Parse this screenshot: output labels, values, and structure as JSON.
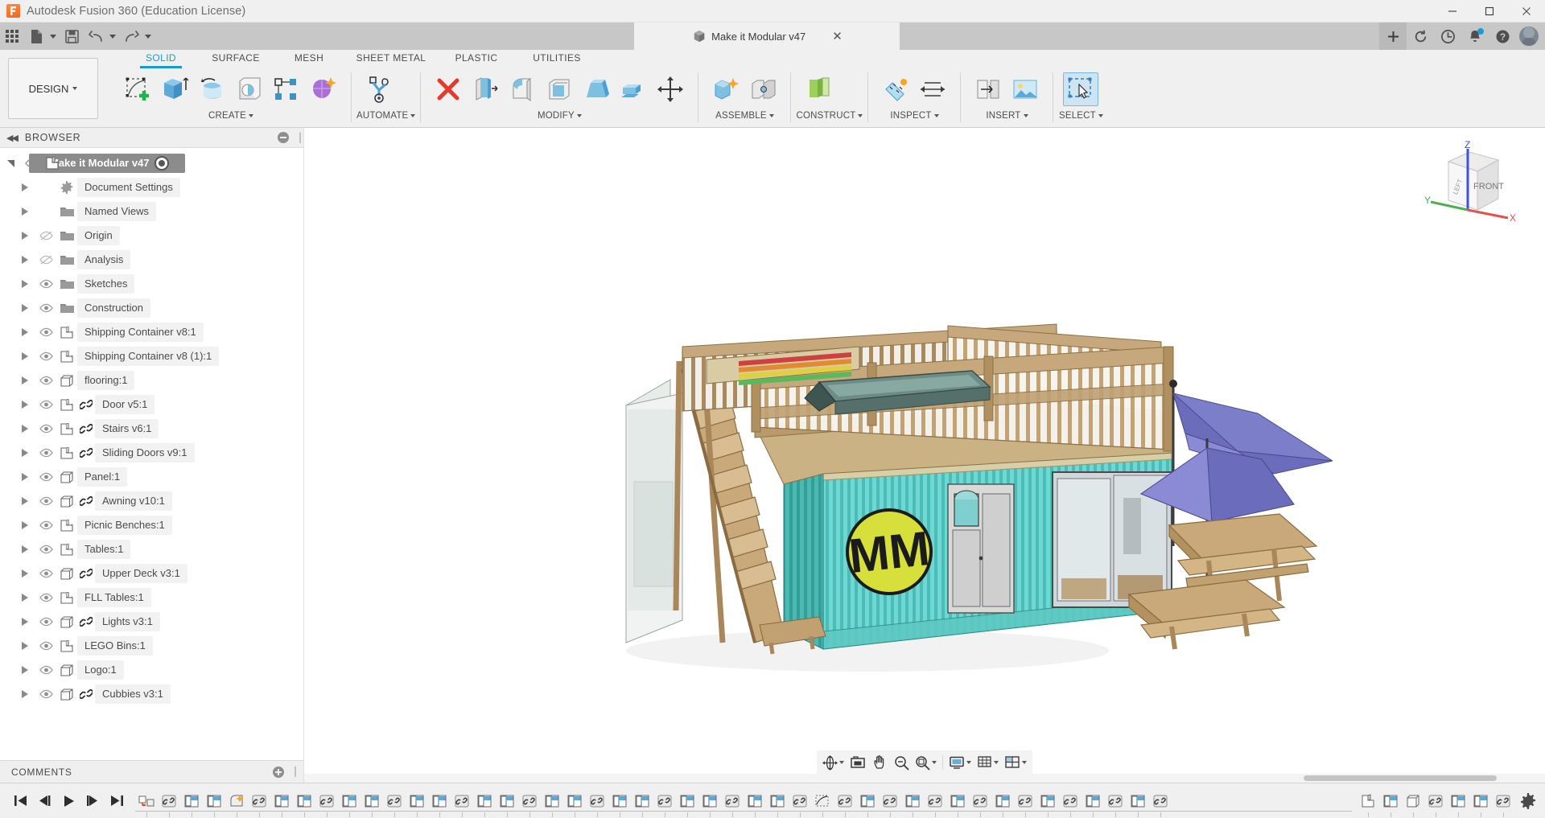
{
  "titlebar": {
    "app_title": "Autodesk Fusion 360 (Education License)",
    "icon": "fusion-logo-icon",
    "minimize": "–",
    "maximize": "□",
    "close": "✕"
  },
  "quick_access": {
    "app_grid": "grid-icon",
    "new_file": "new-file-icon",
    "save": "save-icon",
    "undo": "undo-icon",
    "redo": "redo-icon",
    "document_tab": {
      "title": "Make it Modular v47",
      "close": "✕"
    },
    "add_tab": "+",
    "sync_icon": "sync-icon",
    "history_icon": "clock-icon",
    "notifications_icon": "bell-icon",
    "help_icon": "help-icon",
    "avatar": "user-avatar"
  },
  "ribbon": {
    "workspace": "DESIGN",
    "tabs": [
      {
        "label": "SOLID",
        "active": true
      },
      {
        "label": "SURFACE",
        "active": false
      },
      {
        "label": "MESH",
        "active": false
      },
      {
        "label": "SHEET METAL",
        "active": false
      },
      {
        "label": "PLASTIC",
        "active": false
      },
      {
        "label": "UTILITIES",
        "active": false
      }
    ],
    "panels": [
      {
        "label": "CREATE",
        "has_caret": true,
        "tools": [
          "create-sketch-icon",
          "extrude-icon",
          "revolve-icon",
          "hole-icon",
          "pattern-icon",
          "form-icon"
        ]
      },
      {
        "label": "AUTOMATE",
        "has_caret": true,
        "tools": [
          "automate-generative-icon"
        ]
      },
      {
        "label": "MODIFY",
        "has_caret": true,
        "tools": [
          "delete-icon",
          "press-pull-icon",
          "fillet-icon",
          "shell-icon",
          "draft-icon",
          "combine-icon",
          "move-copy-icon"
        ]
      },
      {
        "label": "ASSEMBLE",
        "has_caret": true,
        "tools": [
          "new-component-icon",
          "joint-icon"
        ]
      },
      {
        "label": "CONSTRUCT",
        "has_caret": true,
        "tools": [
          "offset-plane-icon"
        ]
      },
      {
        "label": "INSPECT",
        "has_caret": true,
        "tools": [
          "measure-icon",
          "section-analysis-icon"
        ]
      },
      {
        "label": "INSERT",
        "has_caret": true,
        "tools": [
          "insert-derive-icon",
          "insert-image-icon"
        ]
      },
      {
        "label": "SELECT",
        "has_caret": true,
        "tools": [
          "select-icon"
        ]
      }
    ]
  },
  "browser": {
    "header": "BROWSER",
    "collapse_icon": "collapse-left-icon",
    "root": {
      "label": "Make it Modular v47",
      "icon": "component-icon",
      "expanded": true,
      "activate_icon": "activate-component-icon"
    },
    "items": [
      {
        "label": "Document Settings",
        "icon": "gear-icon",
        "eye": "none",
        "link": false
      },
      {
        "label": "Named Views",
        "icon": "folder-icon",
        "eye": "none",
        "link": false
      },
      {
        "label": "Origin",
        "icon": "folder-icon",
        "eye": "hidden",
        "link": false
      },
      {
        "label": "Analysis",
        "icon": "folder-icon",
        "eye": "hidden",
        "link": false
      },
      {
        "label": "Sketches",
        "icon": "folder-icon",
        "eye": "visible",
        "link": false
      },
      {
        "label": "Construction",
        "icon": "folder-icon",
        "eye": "visible",
        "link": false
      },
      {
        "label": "Shipping Container v8:1",
        "icon": "component-icon",
        "eye": "visible",
        "link": false
      },
      {
        "label": "Shipping Container v8 (1):1",
        "icon": "component-icon",
        "eye": "visible",
        "link": false
      },
      {
        "label": "flooring:1",
        "icon": "body-icon",
        "eye": "visible",
        "link": false
      },
      {
        "label": "Door v5:1",
        "icon": "component-icon",
        "eye": "visible",
        "link": true
      },
      {
        "label": "Stairs v6:1",
        "icon": "component-icon",
        "eye": "visible",
        "link": true
      },
      {
        "label": "Sliding Doors v9:1",
        "icon": "component-icon",
        "eye": "visible",
        "link": true
      },
      {
        "label": "Panel:1",
        "icon": "body-icon",
        "eye": "visible",
        "link": false
      },
      {
        "label": "Awning v10:1",
        "icon": "body-icon",
        "eye": "visible",
        "link": true
      },
      {
        "label": "Picnic Benches:1",
        "icon": "component-icon",
        "eye": "visible",
        "link": false
      },
      {
        "label": "Tables:1",
        "icon": "component-icon",
        "eye": "visible",
        "link": false
      },
      {
        "label": "Upper Deck v3:1",
        "icon": "body-icon",
        "eye": "visible",
        "link": true
      },
      {
        "label": "FLL Tables:1",
        "icon": "component-icon",
        "eye": "visible",
        "link": false
      },
      {
        "label": "Lights v3:1",
        "icon": "body-icon",
        "eye": "visible",
        "link": true
      },
      {
        "label": "LEGO Bins:1",
        "icon": "component-icon",
        "eye": "visible",
        "link": false
      },
      {
        "label": "Logo:1",
        "icon": "body-icon",
        "eye": "visible",
        "link": false
      },
      {
        "label": "Cubbies v3:1",
        "icon": "body-icon",
        "eye": "visible",
        "link": true
      }
    ],
    "comments": {
      "label": "COMMENTS",
      "add_icon": "add-comment-icon"
    }
  },
  "viewcube": {
    "face_label": "FRONT",
    "side_label": "LEFT",
    "axis_x": "X",
    "axis_y": "Y",
    "axis_z": "Z",
    "axis_x_color": "#e4504a",
    "axis_y_color": "#4caf50",
    "axis_z_color": "#3f51e5"
  },
  "nav_toolbar": {
    "buttons": [
      {
        "name": "orbit-icon",
        "caret": true
      },
      {
        "name": "look-at-icon",
        "caret": false
      },
      {
        "name": "pan-icon",
        "caret": false
      },
      {
        "name": "zoom-icon",
        "caret": false
      },
      {
        "name": "fit-icon",
        "caret": true
      },
      {
        "name": "display-settings-icon",
        "caret": true
      },
      {
        "name": "grid-snap-icon",
        "caret": true
      },
      {
        "name": "viewports-icon",
        "caret": true
      }
    ]
  },
  "timeline": {
    "playback": [
      "go-to-beginning-icon",
      "step-back-icon",
      "play-icon",
      "step-forward-icon",
      "go-to-end-icon"
    ],
    "features": [
      "move-copy-feature",
      "joint-feature",
      "extrude-feature",
      "extrude-feature",
      "fillet-feature",
      "joint-feature",
      "extrude-feature",
      "extrude-feature",
      "joint-feature",
      "extrude-feature",
      "extrude-feature",
      "joint-feature",
      "extrude-feature",
      "extrude-feature",
      "joint-feature",
      "extrude-feature",
      "extrude-feature",
      "joint-feature",
      "extrude-feature",
      "extrude-feature",
      "joint-feature",
      "extrude-feature",
      "extrude-feature",
      "joint-feature",
      "extrude-feature",
      "extrude-feature",
      "joint-feature",
      "extrude-feature",
      "extrude-feature",
      "joint-feature",
      "sketch-feature",
      "joint-feature",
      "extrude-feature",
      "joint-feature",
      "extrude-feature",
      "joint-feature",
      "extrude-feature",
      "joint-feature",
      "extrude-feature",
      "joint-feature",
      "extrude-feature",
      "joint-feature",
      "extrude-feature",
      "joint-feature",
      "extrude-feature",
      "joint-feature"
    ],
    "end_features": [
      "component-feature",
      "extrude-feature",
      "body-feature",
      "joint-feature",
      "extrude-feature",
      "extrude-feature",
      "joint-feature"
    ],
    "settings_icon": "gear-icon"
  },
  "model": {
    "description": "3D shaded model of a modular shipping-container building with upper deck railing, stairs, sliding doors, picnic tables and purple umbrellas",
    "logo_text": "MM",
    "logo_color": "#d7e03a",
    "container_color": "#6fd8d2",
    "wood_color": "#c8a877",
    "umbrella_color": "#6e6fc4"
  }
}
